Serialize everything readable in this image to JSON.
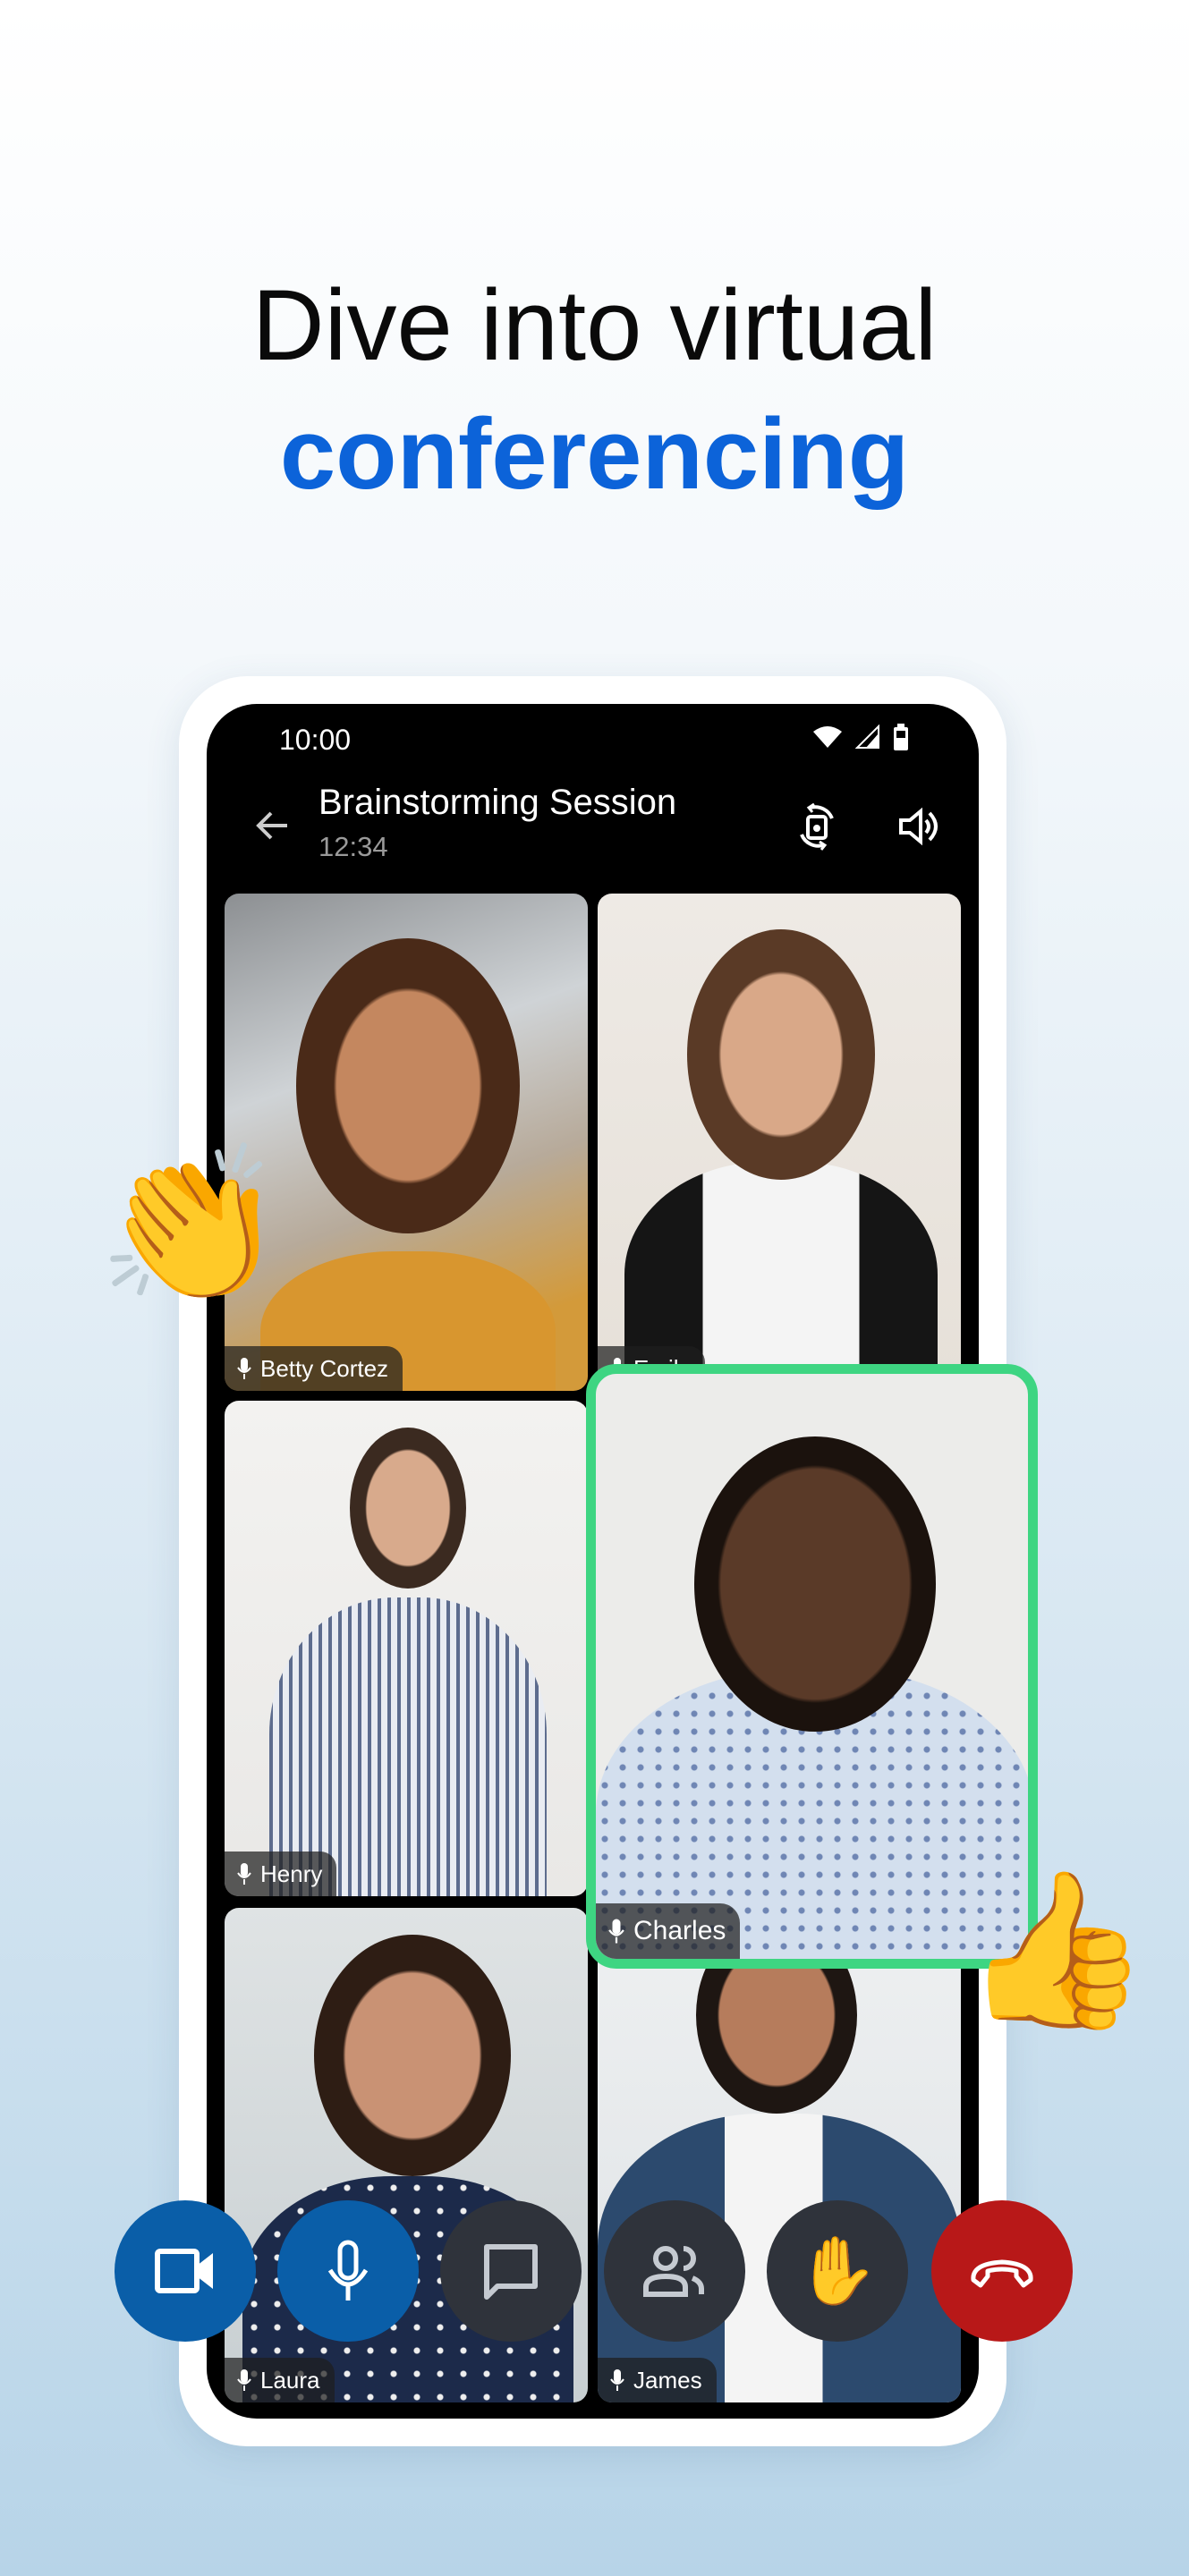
{
  "headline": {
    "line1": "Dive into virtual",
    "line2": "conferencing"
  },
  "colors": {
    "accent": "#0c63d9",
    "active_speaker": "#3ed582",
    "control_blue": "#0a5ea8",
    "control_dark": "#2f333b",
    "end_call": "#b81818"
  },
  "status_bar": {
    "time": "10:00",
    "icons": [
      "wifi-icon",
      "signal-icon",
      "battery-icon"
    ]
  },
  "call_header": {
    "title": "Brainstorming Session",
    "duration": "12:34",
    "icons": [
      "back-arrow-icon",
      "switch-camera-icon",
      "speaker-icon"
    ]
  },
  "participants": [
    {
      "name": "Betty Cortez"
    },
    {
      "name": "Emily"
    },
    {
      "name": "Henry"
    },
    {
      "name": "Charles",
      "active_speaker": true
    },
    {
      "name": "Laura"
    },
    {
      "name": "James"
    }
  ],
  "controls": [
    "camera-icon",
    "microphone-icon",
    "chat-icon",
    "participants-icon",
    "raise-hand-icon",
    "end-call-icon"
  ],
  "decorations": {
    "left": "👏",
    "right": "👍",
    "hand": "✋"
  }
}
